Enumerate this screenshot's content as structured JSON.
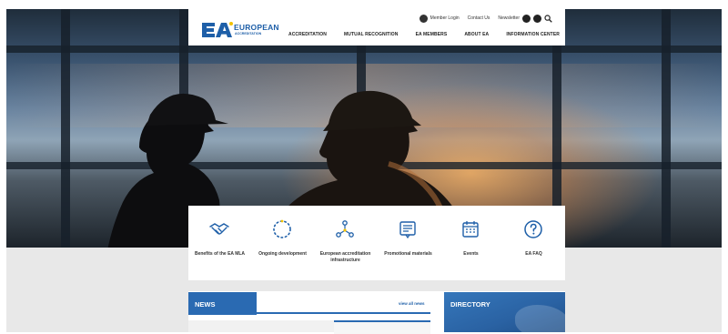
{
  "logo": {
    "name": "EUROPEAN",
    "sub": "ACCREDITATION"
  },
  "utility": {
    "member_login": "Member Login",
    "contact": "Contact Us",
    "newsletter": "Newsletter",
    "icons": [
      "user-icon",
      "facebook-icon",
      "youtube-icon",
      "search-icon"
    ]
  },
  "nav": [
    "ACCREDITATION",
    "MUTUAL RECOGNITION",
    "EA MEMBERS",
    "ABOUT EA",
    "INFORMATION CENTER"
  ],
  "quick_links": [
    {
      "icon": "handshake-icon",
      "label": "Benefits of the EA MLA"
    },
    {
      "icon": "dotted-circle-icon",
      "label": "Ongoing development"
    },
    {
      "icon": "network-icon",
      "label": "European accreditation infrastructure"
    },
    {
      "icon": "document-icon",
      "label": "Promotional materials"
    },
    {
      "icon": "calendar-icon",
      "label": "Events"
    },
    {
      "icon": "question-icon",
      "label": "EA FAQ"
    }
  ],
  "news": {
    "title": "NEWS",
    "view_all": "view all news"
  },
  "directory": {
    "title": "DIRECTORY"
  },
  "colors": {
    "brand_blue": "#1e5fa8",
    "bar_blue": "#2a6ab2",
    "accent_yellow": "#f2c200"
  }
}
